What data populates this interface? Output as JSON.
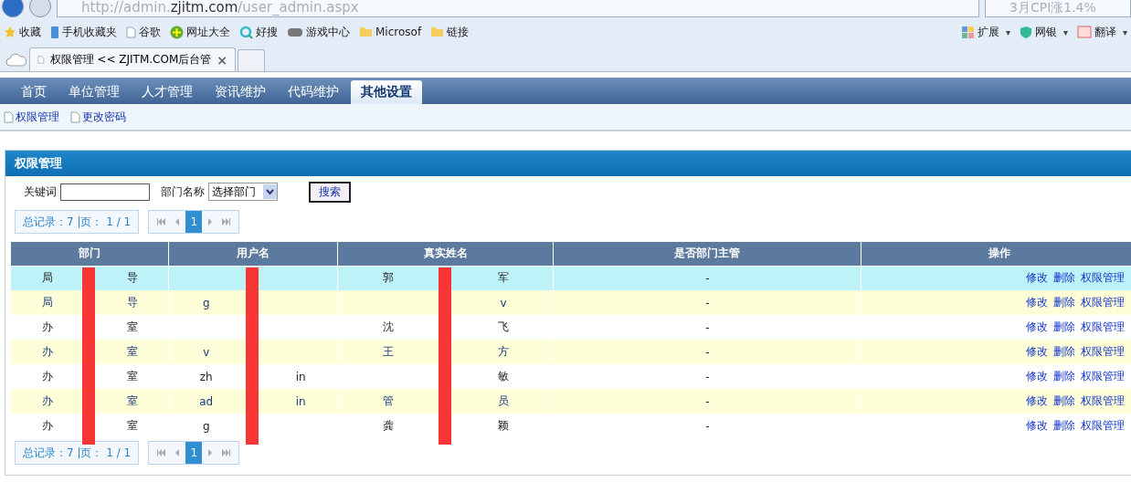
{
  "browser": {
    "address": {
      "scheme": "http://admin.",
      "host": "zjitm.com",
      "path": "/user_admin.aspx"
    },
    "search": {
      "placeholder": "3月CPI涨1.4%"
    },
    "bookmarks": [
      {
        "kind": "star",
        "label": "收藏"
      },
      {
        "kind": "phone",
        "label": "手机收藏夹"
      },
      {
        "kind": "page",
        "label": "谷歌"
      },
      {
        "kind": "plus",
        "label": "网址大全"
      },
      {
        "kind": "ring",
        "label": "好搜"
      },
      {
        "kind": "game",
        "label": "游戏中心"
      },
      {
        "kind": "folder",
        "label": "Microsof"
      },
      {
        "kind": "folder",
        "label": "链接"
      }
    ],
    "tools": [
      {
        "kind": "grid",
        "label": "扩展",
        "menu": "▾"
      },
      {
        "kind": "shield",
        "label": "网银",
        "menu": "▾"
      },
      {
        "kind": "dict",
        "label": "翻译",
        "menu": "▾"
      }
    ],
    "tab": {
      "title": "权限管理 << ZJITM.COM后台管",
      "close": "×"
    }
  },
  "nav": [
    {
      "label": "首页",
      "selected": false
    },
    {
      "label": "单位管理",
      "selected": false
    },
    {
      "label": "人才管理",
      "selected": false
    },
    {
      "label": "资讯维护",
      "selected": false
    },
    {
      "label": "代码维护",
      "selected": false
    },
    {
      "label": "其他设置",
      "selected": true
    }
  ],
  "subnav": [
    "权限管理",
    "更改密码"
  ],
  "panel": {
    "title": "权限管理",
    "keyword_label": "关键词",
    "dept_label": "部门名称",
    "dept_select": "选择部门",
    "search_button": "搜索",
    "pagers": [
      {
        "summary": "总记录：7 |页： 1 / 1",
        "pages": [
          {
            "label": "1",
            "selected": true
          }
        ]
      },
      {
        "summary": "总记录：7 |页： 1 / 1",
        "pages": [
          {
            "label": "1",
            "selected": true
          }
        ]
      }
    ],
    "columns": [
      "部门",
      "用户名",
      "真实姓名",
      "是否部门主管",
      "操作"
    ],
    "rows": [
      {
        "selected": true,
        "dept": {
          "left": "局",
          "right": "导"
        },
        "user": {},
        "name": {
          "left": "郭",
          "right": "军"
        },
        "manager": "-",
        "actions": [
          "修改",
          "删除",
          "权限管理"
        ]
      },
      {
        "selected": false,
        "dept": {
          "left": "局",
          "right": "导"
        },
        "user": {
          "left": "g"
        },
        "name": {
          "right": "v"
        },
        "manager": "-",
        "actions": [
          "修改",
          "删除",
          "权限管理"
        ]
      },
      {
        "selected": false,
        "dept": {
          "left": "办",
          "right": "室"
        },
        "user": {},
        "name": {
          "left": "沈",
          "right": "飞"
        },
        "manager": "-",
        "actions": [
          "修改",
          "删除",
          "权限管理"
        ]
      },
      {
        "selected": false,
        "dept": {
          "left": "办",
          "right": "室"
        },
        "user": {
          "left": "v"
        },
        "name": {
          "left": "王",
          "right": "方"
        },
        "manager": "-",
        "actions": [
          "修改",
          "删除",
          "权限管理"
        ]
      },
      {
        "selected": false,
        "dept": {
          "left": "办",
          "right": "室"
        },
        "user": {
          "left": "zh",
          "right": "in"
        },
        "name": {
          "right": "敏"
        },
        "manager": "-",
        "actions": [
          "修改",
          "删除",
          "权限管理"
        ]
      },
      {
        "selected": false,
        "dept": {
          "left": "办",
          "right": "室"
        },
        "user": {
          "left": "ad",
          "right": "in"
        },
        "name": {
          "left": "管",
          "right": "员"
        },
        "manager": "-",
        "actions": [
          "修改",
          "删除",
          "权限管理"
        ]
      },
      {
        "selected": false,
        "dept": {
          "left": "办",
          "right": "室"
        },
        "user": {
          "left": "g"
        },
        "name": {
          "left": "龚",
          "right": "颖"
        },
        "manager": "-",
        "actions": [
          "修改",
          "删除",
          "权限管理"
        ]
      }
    ]
  }
}
